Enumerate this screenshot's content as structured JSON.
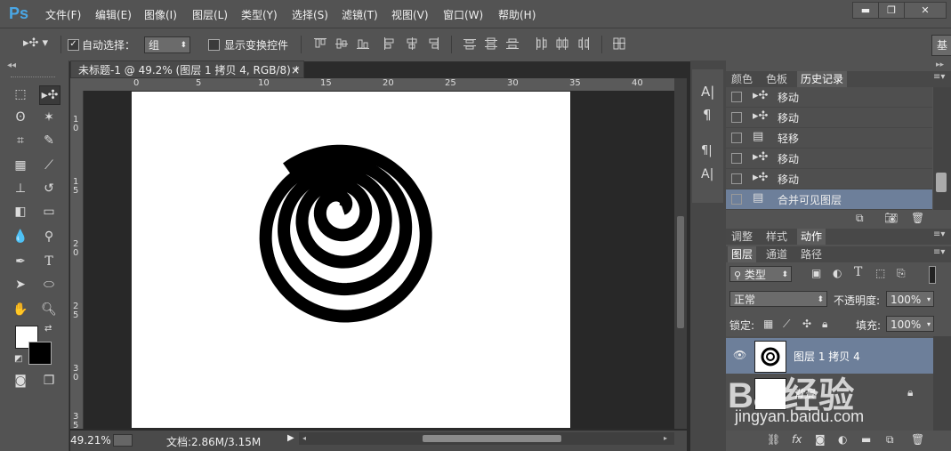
{
  "app": {
    "logo": "Ps",
    "menu": [
      "文件(F)",
      "编辑(E)",
      "图像(I)",
      "图层(L)",
      "类型(Y)",
      "选择(S)",
      "滤镜(T)",
      "视图(V)",
      "窗口(W)",
      "帮助(H)"
    ],
    "window_buttons": [
      "▬",
      "❐",
      "✕"
    ]
  },
  "options": {
    "auto_select_label": "自动选择：",
    "auto_select_checked": true,
    "auto_select_value": "组",
    "show_transform_label": "显示变换控件"
  },
  "document": {
    "tab_title": "未标题-1 @ 49.2% (图层 1 拷贝 4, RGB/8) *",
    "close": "×",
    "ruler_top": [
      "0",
      "5",
      "10",
      "15",
      "20",
      "25",
      "30",
      "35",
      "40"
    ],
    "ruler_left": [
      "1\n0",
      "1\n5",
      "2\n0",
      "2\n5",
      "3\n0",
      "3\n5"
    ]
  },
  "status": {
    "zoom": "49.21%",
    "doc_info": "文档:2.86M/3.15M"
  },
  "history_panel": {
    "tabs": [
      "颜色",
      "色板",
      "历史记录"
    ],
    "active_tab": 2,
    "items": [
      {
        "icon": "move-tool-icon",
        "label": "移动",
        "selected": false
      },
      {
        "icon": "move-tool-icon",
        "label": "移动",
        "selected": false
      },
      {
        "icon": "document-icon",
        "label": "轻移",
        "selected": false
      },
      {
        "icon": "move-tool-icon",
        "label": "移动",
        "selected": false
      },
      {
        "icon": "move-tool-icon",
        "label": "移动",
        "selected": false
      },
      {
        "icon": "document-icon",
        "label": "合并可见图层",
        "selected": true
      }
    ]
  },
  "adjust_panel": {
    "tabs": [
      "调整",
      "样式",
      "动作"
    ],
    "active_tab": 2
  },
  "layers_panel": {
    "tabs": [
      "图层",
      "通道",
      "路径"
    ],
    "active_tab": 0,
    "kind_filter": "类型",
    "blend_mode": "正常",
    "opacity_label": "不透明度:",
    "opacity_value": "100%",
    "lock_label": "锁定:",
    "fill_label": "填充:",
    "fill_value": "100%",
    "layers": [
      {
        "name": "图层 1 拷贝 4",
        "visible": true,
        "selected": true
      },
      {
        "name": "背景",
        "visible": false,
        "selected": false,
        "locked": true
      }
    ]
  },
  "watermark": {
    "brand": "Bai经验",
    "url": "jingyan.baidu.com"
  },
  "colors": {
    "ui_bg": "#535353",
    "selected_row": "#6d7f9a",
    "ps_blue": "#4aa7e6"
  }
}
